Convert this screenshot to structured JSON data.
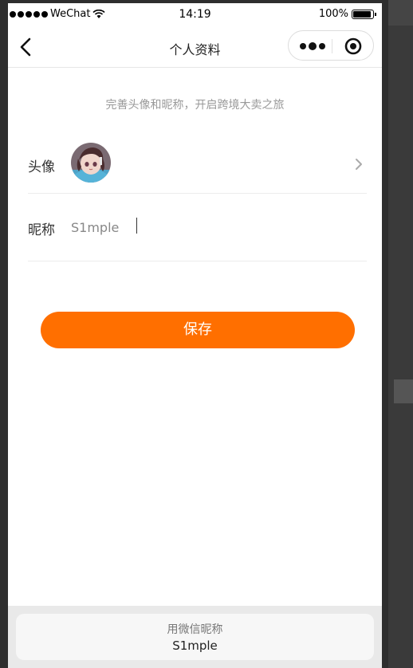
{
  "status_bar": {
    "carrier": "WeChat",
    "time": "14:19",
    "battery": "100%"
  },
  "navbar": {
    "title": "个人资料",
    "back_icon": "chevron-left-icon",
    "more_icon": "more-dots-icon",
    "close_icon": "record-circle-icon"
  },
  "tip": "完善头像和昵称，开启跨境大卖之旅",
  "avatar_row": {
    "label": "头像",
    "arrow_icon": "chevron-right-icon"
  },
  "nickname_row": {
    "label": "昵称",
    "value": "S1mple"
  },
  "save_button": "保存",
  "wechat_nickname_sheet": {
    "title": "用微信昵称",
    "nickname": "S1mple"
  },
  "colors": {
    "accent": "#ff6f00",
    "tip_text": "#999999"
  }
}
